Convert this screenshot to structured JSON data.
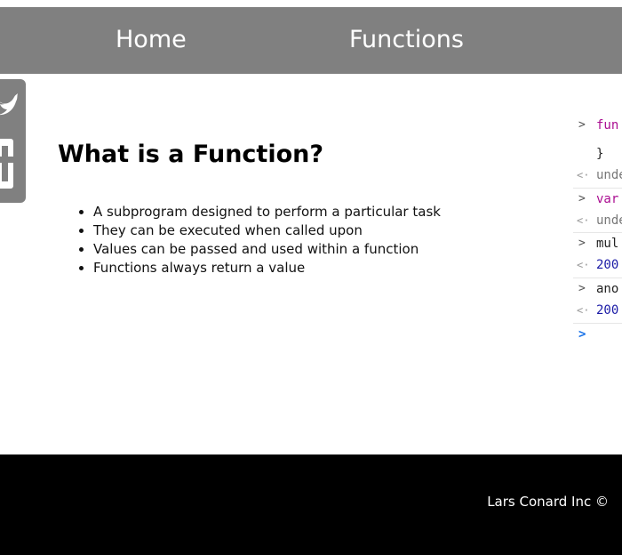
{
  "nav": {
    "home_label": "Home",
    "functions_label": "Functions"
  },
  "social": {
    "icons": [
      "twitter-icon",
      "facebook-icon"
    ]
  },
  "main": {
    "title": "What is a Function?",
    "bullets": [
      "A subprogram designed to perform a particular task",
      "They can be executed when called upon",
      "Values can be passed and used within a function",
      "Functions always return a value"
    ]
  },
  "console": {
    "lines": [
      {
        "kind": "input",
        "text": "fun"
      },
      {
        "kind": "continuation",
        "text": "}"
      },
      {
        "kind": "output",
        "text": "unde"
      },
      {
        "kind": "input",
        "text": "var"
      },
      {
        "kind": "output",
        "text": "unde"
      },
      {
        "kind": "input",
        "text": "mul"
      },
      {
        "kind": "output",
        "text": "200"
      },
      {
        "kind": "input",
        "text": "ano"
      },
      {
        "kind": "output",
        "text": "200"
      }
    ]
  },
  "footer": {
    "text": "Lars Conard Inc ©"
  },
  "colors": {
    "nav_bg": "#808080",
    "footer_bg": "#000000",
    "keyword": "#aa0d91",
    "number": "#1a1aa6"
  }
}
